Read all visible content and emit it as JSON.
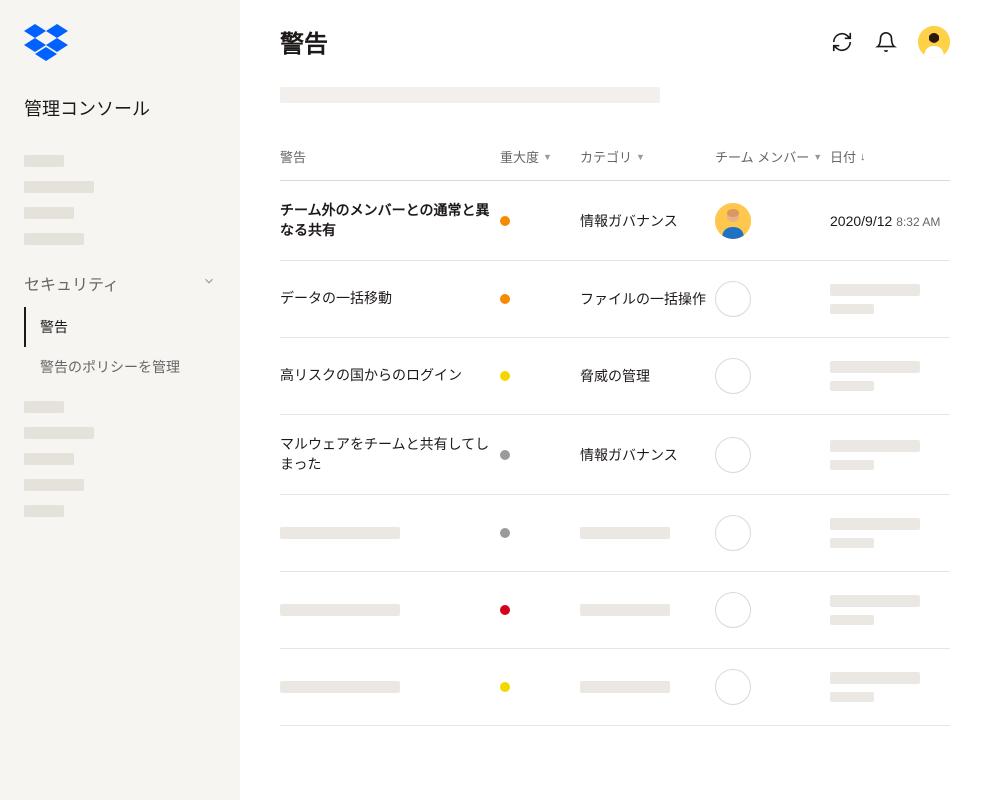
{
  "sidebar": {
    "title": "管理コンソール",
    "security_label": "セキュリティ",
    "subitems": [
      {
        "label": "警告",
        "active": true
      },
      {
        "label": "警告のポリシーを管理",
        "active": false
      }
    ]
  },
  "header": {
    "title": "警告"
  },
  "table": {
    "columns": {
      "alert": "警告",
      "severity": "重大度",
      "category": "カテゴリ",
      "member": "チーム メンバー",
      "date": "日付"
    },
    "rows": [
      {
        "title": "チーム外のメンバーとの通常と異なる共有",
        "bold": true,
        "severity": "orange",
        "category": "情報ガバナンス",
        "member": "avatar",
        "date": "2020/9/12",
        "time": "8:32 AM"
      },
      {
        "title": "データの一括移動",
        "bold": false,
        "severity": "orange",
        "category": "ファイルの一括操作",
        "member": "empty",
        "date": null,
        "time": null
      },
      {
        "title": "高リスクの国からのログイン",
        "bold": false,
        "severity": "yellow",
        "category": "脅威の管理",
        "member": "empty",
        "date": null,
        "time": null
      },
      {
        "title": "マルウェアをチームと共有してしまった",
        "bold": false,
        "severity": "gray",
        "category": "情報ガバナンス",
        "member": "empty",
        "date": null,
        "time": null
      },
      {
        "title": null,
        "severity": "gray",
        "category": null,
        "member": "empty",
        "date": null,
        "time": null
      },
      {
        "title": null,
        "severity": "red",
        "category": null,
        "member": "empty",
        "date": null,
        "time": null
      },
      {
        "title": null,
        "severity": "yellow",
        "category": null,
        "member": "empty",
        "date": null,
        "time": null
      }
    ]
  },
  "colors": {
    "severity": {
      "orange": "#f58b00",
      "yellow": "#f5d700",
      "gray": "#9b9b9b",
      "red": "#d5001a"
    }
  }
}
